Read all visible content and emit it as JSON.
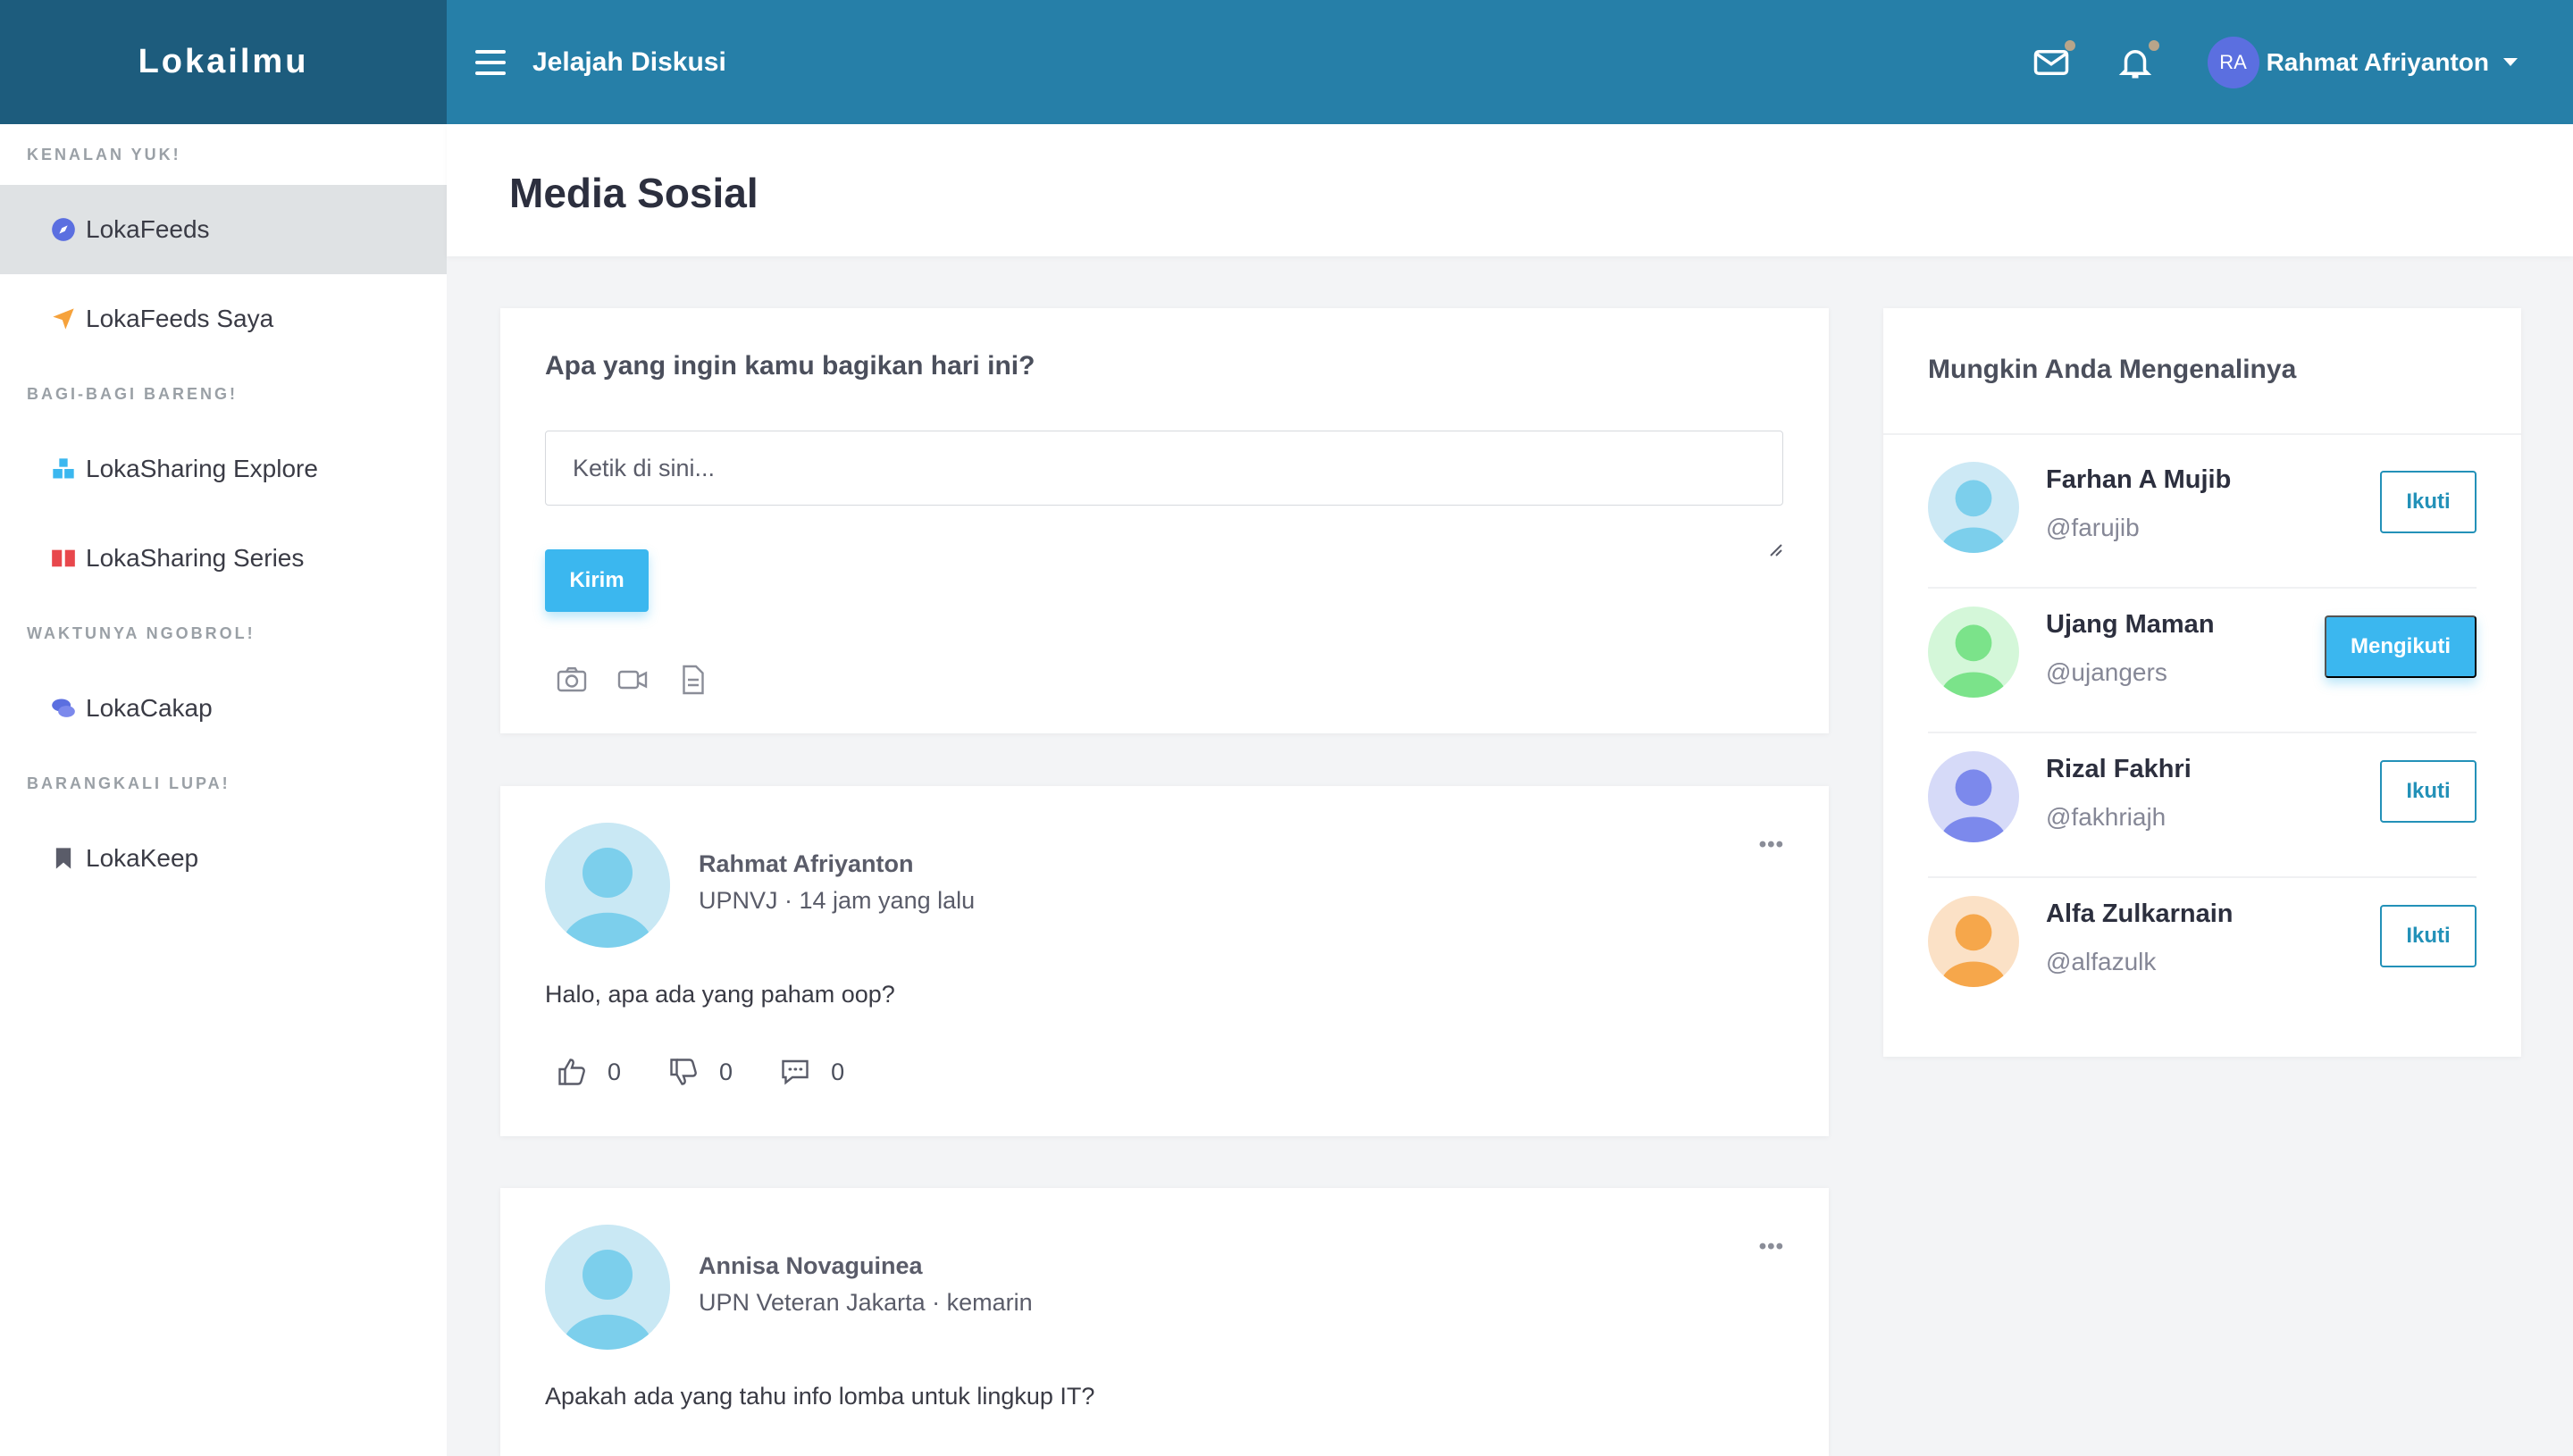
{
  "brand": {
    "name": "Lokailmu"
  },
  "topbar": {
    "title": "Jelajah Diskusi",
    "user_initials": "RA",
    "user_name": "Rahmat Afriyanton"
  },
  "sidebar": {
    "sections": [
      {
        "heading": "KENALAN YUK!",
        "items": [
          {
            "label": "LokaFeeds",
            "icon": "compass-icon",
            "active": true
          },
          {
            "label": "LokaFeeds Saya",
            "icon": "paper-plane-icon"
          }
        ]
      },
      {
        "heading": "BAGI-BAGI BARENG!",
        "items": [
          {
            "label": "LokaSharing Explore",
            "icon": "cubes-icon"
          },
          {
            "label": "LokaSharing Series",
            "icon": "book-open-icon"
          }
        ]
      },
      {
        "heading": "WAKTUNYA NGOBROL!",
        "items": [
          {
            "label": "LokaCakap",
            "icon": "chat-bubbles-icon"
          }
        ]
      },
      {
        "heading": "BARANGKALI LUPA!",
        "items": [
          {
            "label": "LokaKeep",
            "icon": "bookmark-icon"
          }
        ]
      }
    ]
  },
  "page": {
    "title": "Media Sosial"
  },
  "compose": {
    "question": "Apa yang ingin kamu bagikan hari ini?",
    "placeholder": "Ketik di sini...",
    "submit_label": "Kirim"
  },
  "posts": [
    {
      "author": "Rahmat Afriyanton",
      "meta": "UPNVJ · 14 jam yang lalu",
      "text": "Halo, apa ada yang paham oop?",
      "likes": "0",
      "dislikes": "0",
      "comments": "0"
    },
    {
      "author": "Annisa Novaguinea",
      "meta": "UPN Veteran Jakarta · kemarin",
      "text": "Apakah ada yang tahu info lomba untuk lingkup IT?"
    }
  ],
  "suggestions": {
    "title": "Mungkin Anda Mengenalinya",
    "people": [
      {
        "name": "Farhan A Mujib",
        "handle": "@farujib",
        "button": "Ikuti",
        "following": false,
        "bg": "#cde9f5",
        "fg": "#7ccfec"
      },
      {
        "name": "Ujang Maman",
        "handle": "@ujangers",
        "button": "Mengikuti",
        "following": true,
        "bg": "#d4f7d9",
        "fg": "#7be38a"
      },
      {
        "name": "Rizal Fakhri",
        "handle": "@fakhriajh",
        "button": "Ikuti",
        "following": false,
        "bg": "#d6daf8",
        "fg": "#7c89ec"
      },
      {
        "name": "Alfa Zulkarnain",
        "handle": "@alfazulk",
        "button": "Ikuti",
        "following": false,
        "bg": "#fbe1c6",
        "fg": "#f6a74b"
      }
    ]
  },
  "colors": {
    "topbar": "#267fa8",
    "brand_bg": "#1d5c7d",
    "accent": "#3bb7ef",
    "follow_outline": "#2391b8"
  }
}
